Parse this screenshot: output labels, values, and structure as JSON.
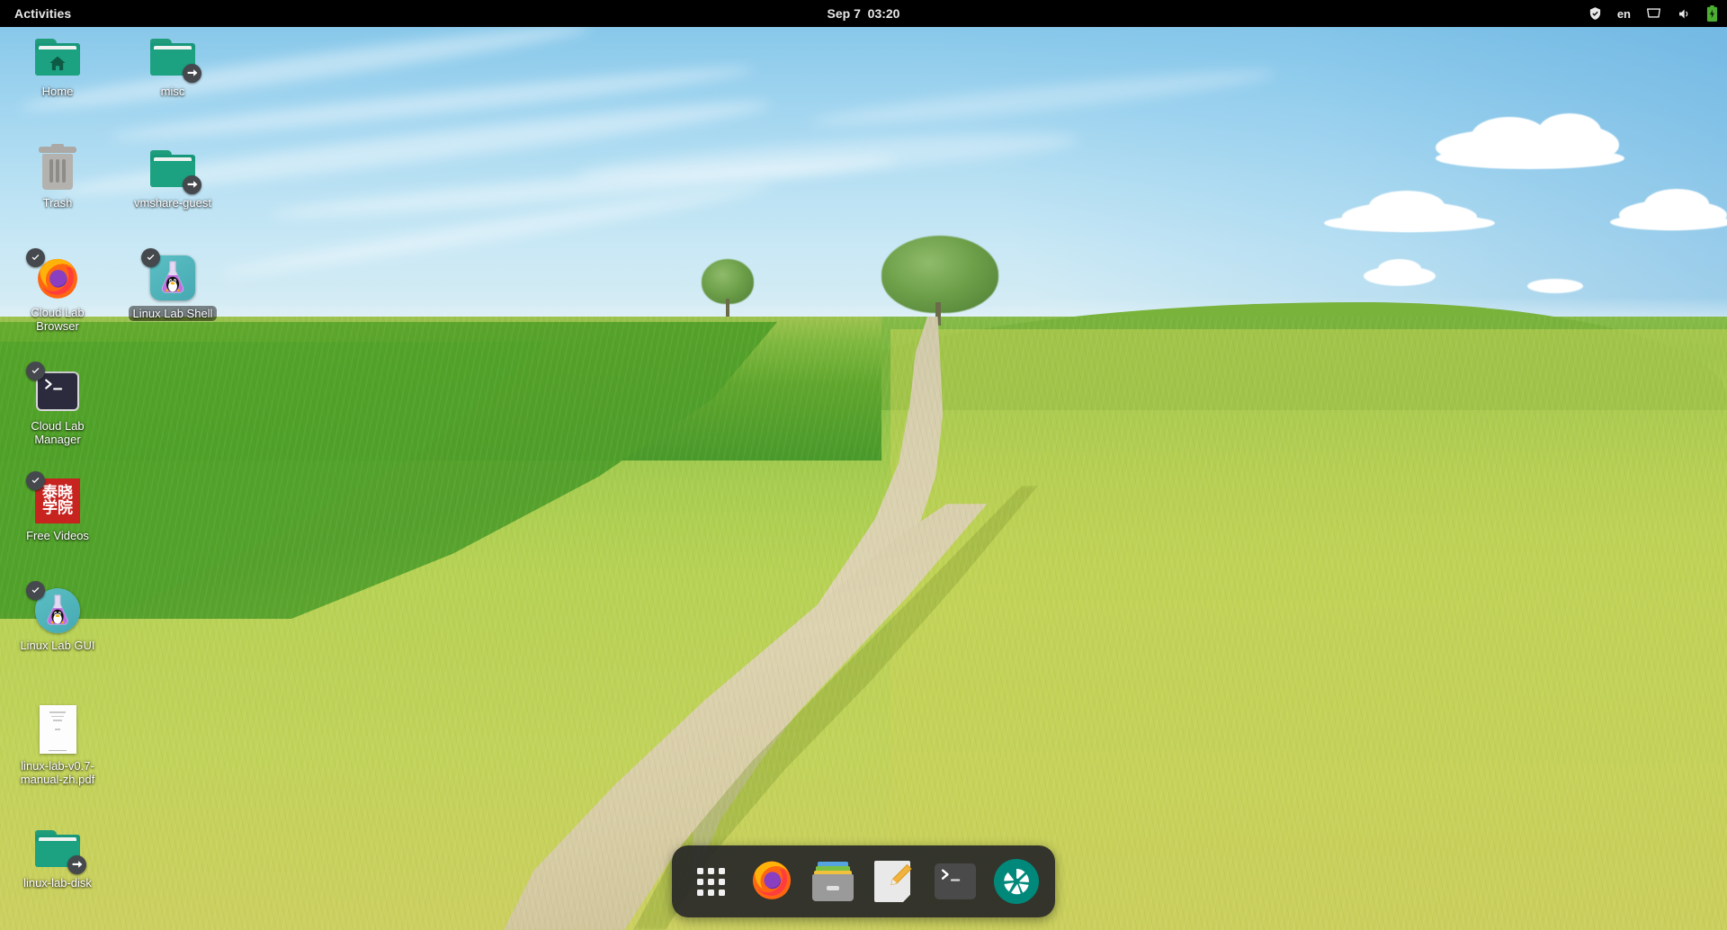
{
  "topbar": {
    "activities_label": "Activities",
    "clock": "Sep 7  03:20",
    "tray": {
      "privacy_icon": "shield-icon",
      "keyboard_layout": "en",
      "display_icon": "display-icon",
      "volume_icon": "volume-icon",
      "battery_icon": "battery-charging-icon"
    }
  },
  "desktop": {
    "icons": [
      {
        "label": "Home",
        "icon": "folder-home-icon",
        "badge": "none",
        "selected": false
      },
      {
        "label": "misc",
        "icon": "folder-link-icon",
        "badge": "symlink",
        "selected": false
      },
      {
        "label": "Trash",
        "icon": "trash-icon",
        "badge": "none",
        "selected": false
      },
      {
        "label": "vmshare-guest",
        "icon": "folder-link-icon",
        "badge": "symlink",
        "selected": false
      },
      {
        "label": "Cloud Lab Browser",
        "icon": "firefox-icon",
        "badge": "check",
        "selected": false
      },
      {
        "label": "Linux Lab Shell",
        "icon": "flask-tux-tile-icon",
        "badge": "check",
        "selected": true
      },
      {
        "label": "Cloud Lab Manager",
        "icon": "terminal-icon",
        "badge": "check",
        "selected": false
      },
      {
        "label": "Free Videos",
        "icon": "tinylab-logo-icon",
        "badge": "check",
        "selected": false,
        "logo_text_top": "泰晓",
        "logo_text_bottom": "学院"
      },
      {
        "label": "Linux Lab GUI",
        "icon": "flask-tux-round-icon",
        "badge": "check",
        "selected": false
      },
      {
        "label": "linux-lab-v0.7-manual-zh.pdf",
        "icon": "pdf-document-icon",
        "badge": "none",
        "selected": false
      },
      {
        "label": "linux-lab-disk",
        "icon": "folder-link-icon",
        "badge": "symlink",
        "selected": false
      }
    ]
  },
  "dock": {
    "items": [
      {
        "name": "show-applications",
        "icon": "app-grid-icon"
      },
      {
        "name": "firefox",
        "icon": "firefox-icon"
      },
      {
        "name": "files",
        "icon": "file-cabinet-icon"
      },
      {
        "name": "text-editor",
        "icon": "notepad-pencil-icon"
      },
      {
        "name": "terminal",
        "icon": "terminal-icon"
      },
      {
        "name": "screenshot",
        "icon": "aperture-icon"
      }
    ]
  },
  "colors": {
    "topbar_bg": "#000000",
    "dock_bg": "#282828",
    "folder_green": "#17987a",
    "accent_teal": "#00897b",
    "battery_green": "#4caf32",
    "logo_red": "#c7231f"
  }
}
